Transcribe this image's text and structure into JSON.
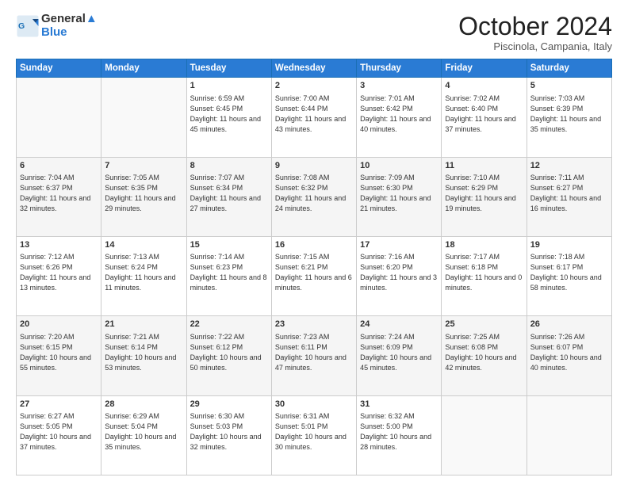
{
  "header": {
    "logo_line1": "General",
    "logo_line2": "Blue",
    "month": "October 2024",
    "location": "Piscinola, Campania, Italy"
  },
  "weekdays": [
    "Sunday",
    "Monday",
    "Tuesday",
    "Wednesday",
    "Thursday",
    "Friday",
    "Saturday"
  ],
  "rows": [
    [
      {
        "day": "",
        "sunrise": "",
        "sunset": "",
        "daylight": ""
      },
      {
        "day": "",
        "sunrise": "",
        "sunset": "",
        "daylight": ""
      },
      {
        "day": "1",
        "sunrise": "Sunrise: 6:59 AM",
        "sunset": "Sunset: 6:45 PM",
        "daylight": "Daylight: 11 hours and 45 minutes."
      },
      {
        "day": "2",
        "sunrise": "Sunrise: 7:00 AM",
        "sunset": "Sunset: 6:44 PM",
        "daylight": "Daylight: 11 hours and 43 minutes."
      },
      {
        "day": "3",
        "sunrise": "Sunrise: 7:01 AM",
        "sunset": "Sunset: 6:42 PM",
        "daylight": "Daylight: 11 hours and 40 minutes."
      },
      {
        "day": "4",
        "sunrise": "Sunrise: 7:02 AM",
        "sunset": "Sunset: 6:40 PM",
        "daylight": "Daylight: 11 hours and 37 minutes."
      },
      {
        "day": "5",
        "sunrise": "Sunrise: 7:03 AM",
        "sunset": "Sunset: 6:39 PM",
        "daylight": "Daylight: 11 hours and 35 minutes."
      }
    ],
    [
      {
        "day": "6",
        "sunrise": "Sunrise: 7:04 AM",
        "sunset": "Sunset: 6:37 PM",
        "daylight": "Daylight: 11 hours and 32 minutes."
      },
      {
        "day": "7",
        "sunrise": "Sunrise: 7:05 AM",
        "sunset": "Sunset: 6:35 PM",
        "daylight": "Daylight: 11 hours and 29 minutes."
      },
      {
        "day": "8",
        "sunrise": "Sunrise: 7:07 AM",
        "sunset": "Sunset: 6:34 PM",
        "daylight": "Daylight: 11 hours and 27 minutes."
      },
      {
        "day": "9",
        "sunrise": "Sunrise: 7:08 AM",
        "sunset": "Sunset: 6:32 PM",
        "daylight": "Daylight: 11 hours and 24 minutes."
      },
      {
        "day": "10",
        "sunrise": "Sunrise: 7:09 AM",
        "sunset": "Sunset: 6:30 PM",
        "daylight": "Daylight: 11 hours and 21 minutes."
      },
      {
        "day": "11",
        "sunrise": "Sunrise: 7:10 AM",
        "sunset": "Sunset: 6:29 PM",
        "daylight": "Daylight: 11 hours and 19 minutes."
      },
      {
        "day": "12",
        "sunrise": "Sunrise: 7:11 AM",
        "sunset": "Sunset: 6:27 PM",
        "daylight": "Daylight: 11 hours and 16 minutes."
      }
    ],
    [
      {
        "day": "13",
        "sunrise": "Sunrise: 7:12 AM",
        "sunset": "Sunset: 6:26 PM",
        "daylight": "Daylight: 11 hours and 13 minutes."
      },
      {
        "day": "14",
        "sunrise": "Sunrise: 7:13 AM",
        "sunset": "Sunset: 6:24 PM",
        "daylight": "Daylight: 11 hours and 11 minutes."
      },
      {
        "day": "15",
        "sunrise": "Sunrise: 7:14 AM",
        "sunset": "Sunset: 6:23 PM",
        "daylight": "Daylight: 11 hours and 8 minutes."
      },
      {
        "day": "16",
        "sunrise": "Sunrise: 7:15 AM",
        "sunset": "Sunset: 6:21 PM",
        "daylight": "Daylight: 11 hours and 6 minutes."
      },
      {
        "day": "17",
        "sunrise": "Sunrise: 7:16 AM",
        "sunset": "Sunset: 6:20 PM",
        "daylight": "Daylight: 11 hours and 3 minutes."
      },
      {
        "day": "18",
        "sunrise": "Sunrise: 7:17 AM",
        "sunset": "Sunset: 6:18 PM",
        "daylight": "Daylight: 11 hours and 0 minutes."
      },
      {
        "day": "19",
        "sunrise": "Sunrise: 7:18 AM",
        "sunset": "Sunset: 6:17 PM",
        "daylight": "Daylight: 10 hours and 58 minutes."
      }
    ],
    [
      {
        "day": "20",
        "sunrise": "Sunrise: 7:20 AM",
        "sunset": "Sunset: 6:15 PM",
        "daylight": "Daylight: 10 hours and 55 minutes."
      },
      {
        "day": "21",
        "sunrise": "Sunrise: 7:21 AM",
        "sunset": "Sunset: 6:14 PM",
        "daylight": "Daylight: 10 hours and 53 minutes."
      },
      {
        "day": "22",
        "sunrise": "Sunrise: 7:22 AM",
        "sunset": "Sunset: 6:12 PM",
        "daylight": "Daylight: 10 hours and 50 minutes."
      },
      {
        "day": "23",
        "sunrise": "Sunrise: 7:23 AM",
        "sunset": "Sunset: 6:11 PM",
        "daylight": "Daylight: 10 hours and 47 minutes."
      },
      {
        "day": "24",
        "sunrise": "Sunrise: 7:24 AM",
        "sunset": "Sunset: 6:09 PM",
        "daylight": "Daylight: 10 hours and 45 minutes."
      },
      {
        "day": "25",
        "sunrise": "Sunrise: 7:25 AM",
        "sunset": "Sunset: 6:08 PM",
        "daylight": "Daylight: 10 hours and 42 minutes."
      },
      {
        "day": "26",
        "sunrise": "Sunrise: 7:26 AM",
        "sunset": "Sunset: 6:07 PM",
        "daylight": "Daylight: 10 hours and 40 minutes."
      }
    ],
    [
      {
        "day": "27",
        "sunrise": "Sunrise: 6:27 AM",
        "sunset": "Sunset: 5:05 PM",
        "daylight": "Daylight: 10 hours and 37 minutes."
      },
      {
        "day": "28",
        "sunrise": "Sunrise: 6:29 AM",
        "sunset": "Sunset: 5:04 PM",
        "daylight": "Daylight: 10 hours and 35 minutes."
      },
      {
        "day": "29",
        "sunrise": "Sunrise: 6:30 AM",
        "sunset": "Sunset: 5:03 PM",
        "daylight": "Daylight: 10 hours and 32 minutes."
      },
      {
        "day": "30",
        "sunrise": "Sunrise: 6:31 AM",
        "sunset": "Sunset: 5:01 PM",
        "daylight": "Daylight: 10 hours and 30 minutes."
      },
      {
        "day": "31",
        "sunrise": "Sunrise: 6:32 AM",
        "sunset": "Sunset: 5:00 PM",
        "daylight": "Daylight: 10 hours and 28 minutes."
      },
      {
        "day": "",
        "sunrise": "",
        "sunset": "",
        "daylight": ""
      },
      {
        "day": "",
        "sunrise": "",
        "sunset": "",
        "daylight": ""
      }
    ]
  ]
}
